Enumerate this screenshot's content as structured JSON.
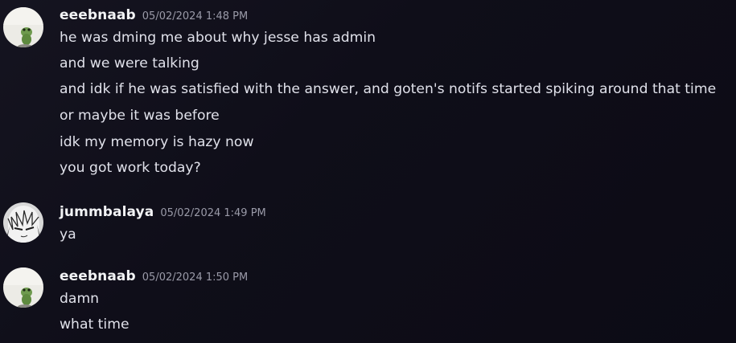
{
  "messages": [
    {
      "username": "eeebnaab",
      "timestamp": "05/02/2024 1:48 PM",
      "avatar_icon": "frog-figurine-avatar",
      "lines": [
        "he was dming me about why jesse has admin",
        "and we were talking",
        "and idk if he was satisfied with the answer, and goten's notifs started spiking around that time",
        "or maybe it was before",
        "idk my memory is hazy now",
        "you got work today?"
      ]
    },
    {
      "username": "jummbalaya",
      "timestamp": "05/02/2024 1:49 PM",
      "avatar_icon": "manga-character-avatar",
      "lines": [
        "ya"
      ]
    },
    {
      "username": "eeebnaab",
      "timestamp": "05/02/2024 1:50 PM",
      "avatar_icon": "frog-figurine-avatar",
      "lines": [
        "damn",
        "what time"
      ]
    }
  ],
  "colors": {
    "background": "#0f0e19",
    "username": "#f2f3f5",
    "timestamp": "#9a9aa8",
    "message_text": "#e0e1ea"
  }
}
